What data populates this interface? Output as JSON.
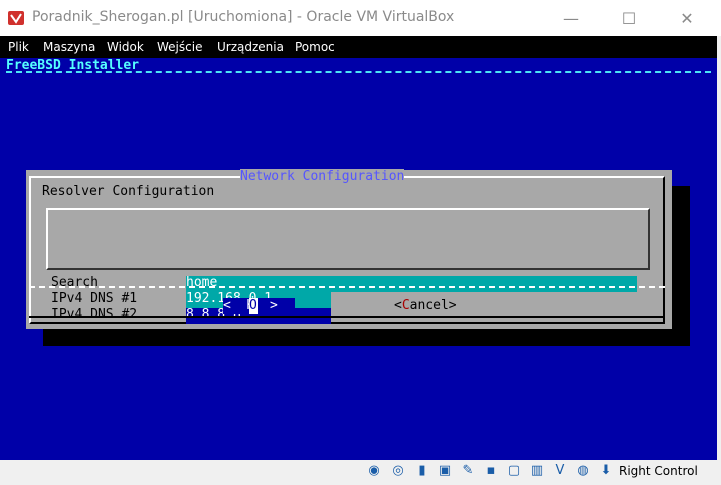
{
  "window": {
    "title": "Poradnik_Sherogan.pl [Uruchomiona] - Oracle VM VirtualBox",
    "minimize": "—",
    "maximize": "☐",
    "close": "✕"
  },
  "menu": [
    "Plik",
    "Maszyna",
    "Widok",
    "Wejście",
    "Urządzenia",
    "Pomoc"
  ],
  "installer": {
    "title": "FreeBSD Installer"
  },
  "dialog": {
    "title": "Network Configuration",
    "subtitle": "Resolver Configuration",
    "fields": [
      {
        "label": "Search",
        "value": "home"
      },
      {
        "label": "IPv4 DNS #1",
        "value": "192.168.0.1"
      },
      {
        "label": "IPv4 DNS #2",
        "value": "8.8.8.8"
      }
    ],
    "ok_left": "<",
    "ok_first": " O",
    "ok_rest": "K  >",
    "ok_cursor": "O",
    "cancel_open": "<",
    "cancel_hot": "C",
    "cancel_rest": "ancel>"
  },
  "statusbar": {
    "host_key": "Right Control",
    "icons": [
      "optical-disk-icon",
      "audio-icon",
      "usb-icon",
      "network-icon",
      "shared-folders-icon",
      "display-icon",
      "video-capture-icon",
      "virtualization-icon",
      "mouse-integration-icon",
      "arrow-down-icon"
    ]
  },
  "colors": {
    "screen_bg": "#0000a8",
    "dialog_bg": "#a8a8a8",
    "field_active": "#00a8a8",
    "title_cyan": "#55ffff",
    "dialog_title": "#5555ff"
  }
}
